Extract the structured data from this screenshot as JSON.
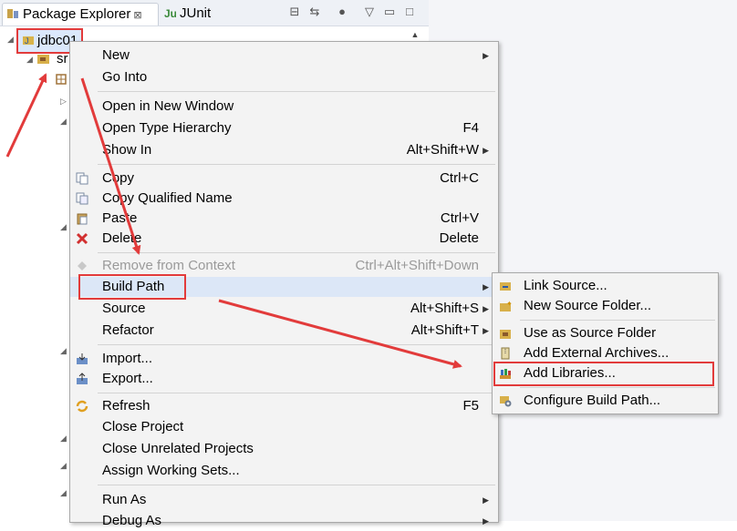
{
  "tabs": {
    "package_explorer": "Package Explorer",
    "junit": "JUnit"
  },
  "tree": {
    "root": "jdbc01",
    "child": "sr"
  },
  "context_menu": {
    "items": [
      {
        "label": "New",
        "shortcut": ""
      },
      {
        "label": "Go Into",
        "shortcut": ""
      },
      {
        "label": "Open in New Window",
        "shortcut": ""
      },
      {
        "label": "Open Type Hierarchy",
        "shortcut": "F4"
      },
      {
        "label": "Show In",
        "shortcut": "Alt+Shift+W"
      },
      {
        "label": "Copy",
        "shortcut": "Ctrl+C"
      },
      {
        "label": "Copy Qualified Name",
        "shortcut": ""
      },
      {
        "label": "Paste",
        "shortcut": "Ctrl+V"
      },
      {
        "label": "Delete",
        "shortcut": "Delete"
      },
      {
        "label": "Remove from Context",
        "shortcut": "Ctrl+Alt+Shift+Down"
      },
      {
        "label": "Build Path",
        "shortcut": ""
      },
      {
        "label": "Source",
        "shortcut": "Alt+Shift+S"
      },
      {
        "label": "Refactor",
        "shortcut": "Alt+Shift+T"
      },
      {
        "label": "Import...",
        "shortcut": ""
      },
      {
        "label": "Export...",
        "shortcut": ""
      },
      {
        "label": "Refresh",
        "shortcut": "F5"
      },
      {
        "label": "Close Project",
        "shortcut": ""
      },
      {
        "label": "Close Unrelated Projects",
        "shortcut": ""
      },
      {
        "label": "Assign Working Sets...",
        "shortcut": ""
      },
      {
        "label": "Run As",
        "shortcut": ""
      },
      {
        "label": "Debug As",
        "shortcut": ""
      }
    ]
  },
  "build_path_submenu": {
    "items": [
      {
        "label": "Link Source..."
      },
      {
        "label": "New Source Folder..."
      },
      {
        "label": "Use as Source Folder"
      },
      {
        "label": "Add External Archives..."
      },
      {
        "label": "Add Libraries..."
      },
      {
        "label": "Configure Build Path..."
      }
    ]
  },
  "colors": {
    "annotation_red": "#e23b3b",
    "menu_bg": "#f3f3f3",
    "highlight": "#dce7f7"
  }
}
